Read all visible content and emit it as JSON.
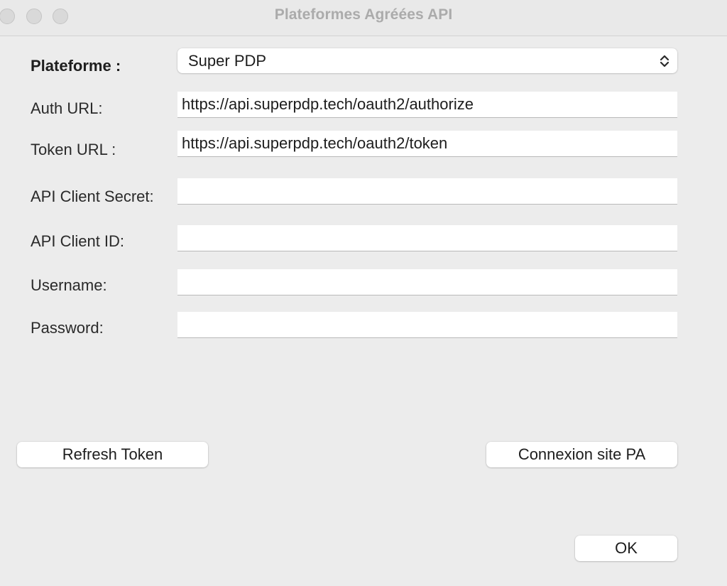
{
  "window": {
    "title": "Plateformes Agréées API"
  },
  "form": {
    "platform_label": "Plateforme :",
    "platform_value": "Super PDP",
    "auth_url_label": "Auth URL:",
    "auth_url_value": "https://api.superpdp.tech/oauth2/authorize",
    "token_url_label": "Token URL :",
    "token_url_value": "https://api.superpdp.tech/oauth2/token",
    "client_secret_label": "API Client Secret:",
    "client_secret_value": "",
    "client_id_label": "API Client ID:",
    "client_id_value": "",
    "username_label": "Username:",
    "username_value": "",
    "password_label": "Password:",
    "password_value": ""
  },
  "buttons": {
    "refresh_token": "Refresh Token",
    "connexion_site": "Connexion site PA",
    "ok": "OK"
  },
  "icons": {
    "window_controls": [
      "close-icon",
      "minimize-icon",
      "zoom-icon"
    ],
    "select_arrows": "chevron-up-down-icon"
  },
  "colors": {
    "window_bg": "#ececec",
    "title_text": "#ababab",
    "field_bg": "#ffffff"
  }
}
